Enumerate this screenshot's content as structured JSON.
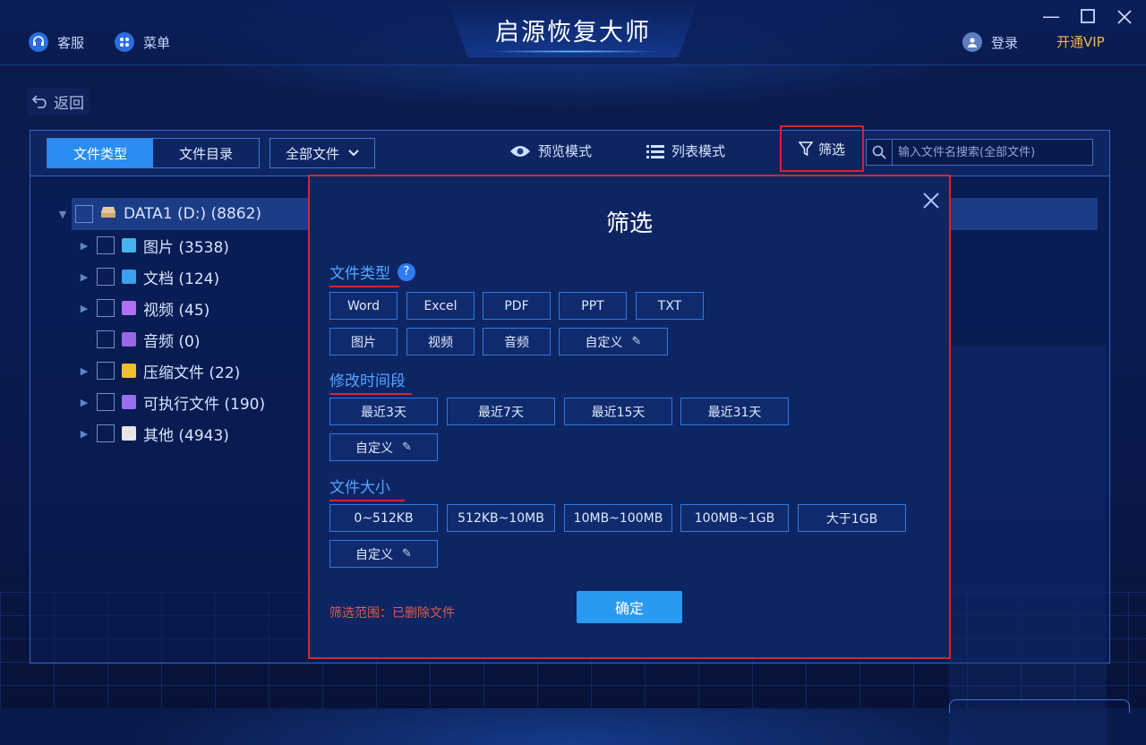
{
  "app": {
    "title": "启源恢复大师"
  },
  "titlebar": {
    "service_label": "客服",
    "menu_label": "菜单",
    "login_label": "登录",
    "vip_label": "开通VIP"
  },
  "nav": {
    "back_label": "返回"
  },
  "toolbar": {
    "tabs": [
      {
        "label": "文件类型",
        "active": true
      },
      {
        "label": "文件目录",
        "active": false
      }
    ],
    "dropdown_value": "全部文件",
    "preview_mode_label": "预览模式",
    "list_mode_label": "列表模式",
    "filter_label": "筛选",
    "search_placeholder": "输入文件名搜索(全部文件)"
  },
  "tree": {
    "root": {
      "label": "DATA1 (D:) (8862)"
    },
    "items": [
      {
        "label": "图片 (3538)",
        "icon": "image-icon",
        "color": "#46b4f0",
        "expandable": true
      },
      {
        "label": "文档 (124)",
        "icon": "document-icon",
        "color": "#3aa0f0",
        "expandable": true
      },
      {
        "label": "视频 (45)",
        "icon": "video-icon",
        "color": "#b06ef0",
        "expandable": true
      },
      {
        "label": "音频 (0)",
        "icon": "audio-icon",
        "color": "#9a66e8",
        "expandable": false
      },
      {
        "label": "压缩文件 (22)",
        "icon": "archive-icon",
        "color": "#f0c02a",
        "expandable": true
      },
      {
        "label": "可执行文件 (190)",
        "icon": "executable-icon",
        "color": "#9a6ef0",
        "expandable": true
      },
      {
        "label": "其他 (4943)",
        "icon": "other-file-icon",
        "color": "#e6e6e6",
        "expandable": true
      }
    ]
  },
  "filter_dialog": {
    "title": "筛选",
    "file_type": {
      "heading": "文件类型",
      "help": "?",
      "options_row1": [
        "Word",
        "Excel",
        "PDF",
        "PPT",
        "TXT"
      ],
      "options_row2": [
        "图片",
        "视频",
        "音频"
      ],
      "custom_label": "自定义"
    },
    "modified_time": {
      "heading": "修改时间段",
      "options": [
        "最近3天",
        "最近7天",
        "最近15天",
        "最近31天"
      ],
      "custom_label": "自定义"
    },
    "file_size": {
      "heading": "文件大小",
      "options": [
        "0~512KB",
        "512KB~10MB",
        "10MB~100MB",
        "100MB~1GB",
        "大于1GB"
      ],
      "custom_label": "自定义"
    },
    "scope_text": "筛选范围：已删除文件",
    "confirm_label": "确定"
  },
  "colors": {
    "accent": "#2b8cf2",
    "highlight_red": "#d8242a",
    "vip": "#f0b64a",
    "background": "#0b1c52"
  }
}
